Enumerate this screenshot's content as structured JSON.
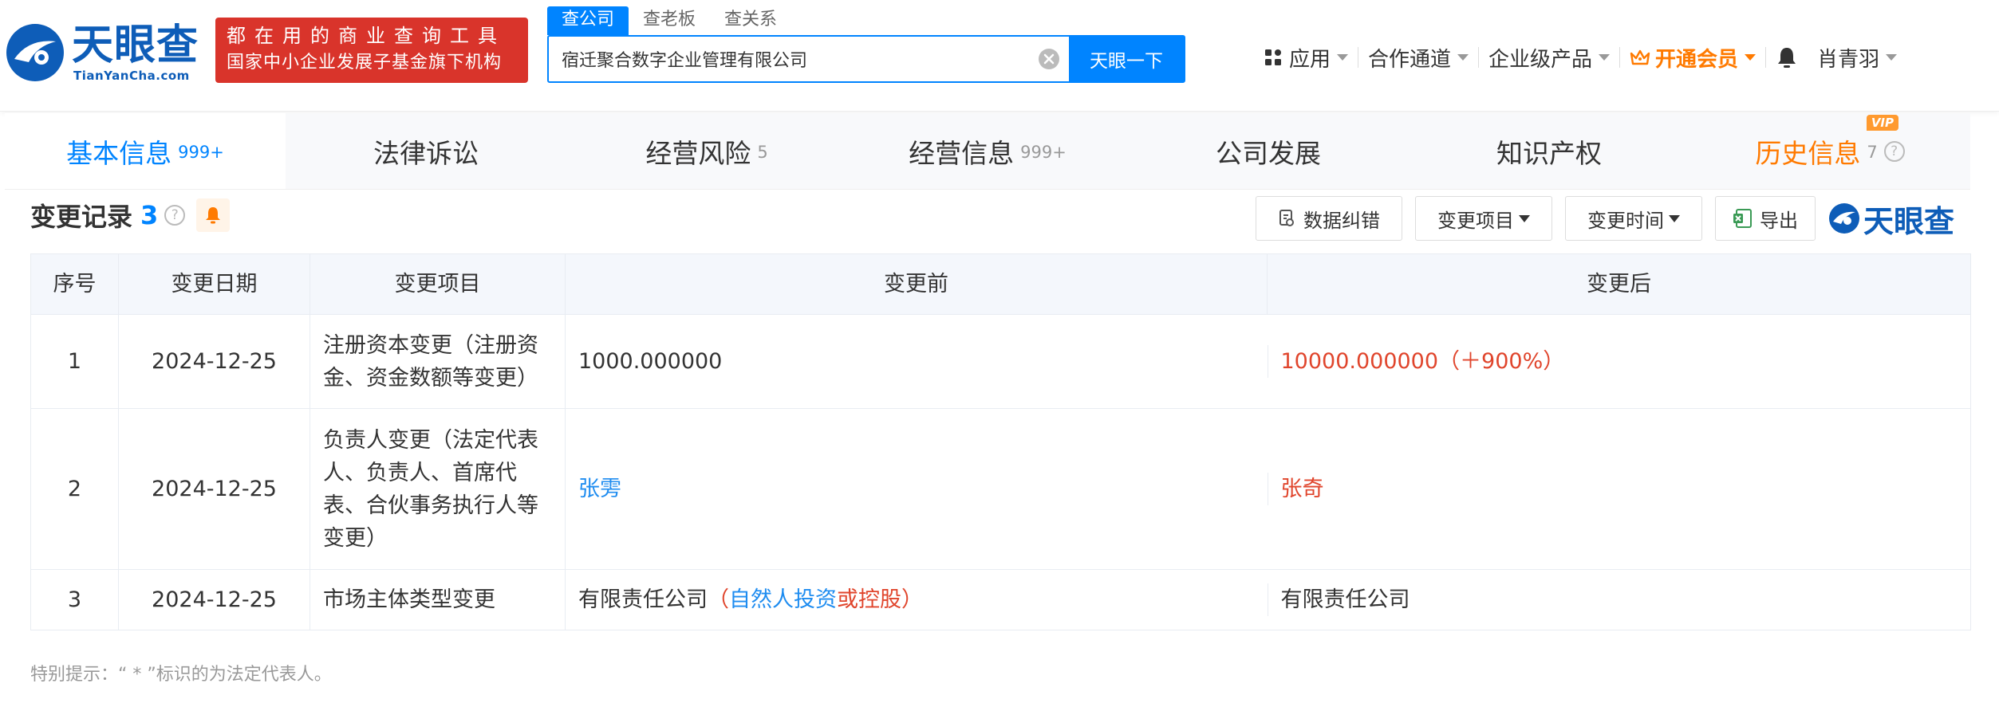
{
  "brand": {
    "name": "天眼查",
    "domain": "TianYanCha.com",
    "promo_line1": "都在用的商业查询工具",
    "promo_line2": "国家中小企业发展子基金旗下机构"
  },
  "search": {
    "tabs": [
      {
        "label": "查公司",
        "active": true
      },
      {
        "label": "查老板",
        "active": false
      },
      {
        "label": "查关系",
        "active": false
      }
    ],
    "value": "宿迁聚合数字企业管理有限公司",
    "button": "天眼一下"
  },
  "nav": {
    "apps": "应用",
    "partner": "合作通道",
    "enterprise": "企业级产品",
    "vip": "开通会员",
    "user": "肖青羽"
  },
  "colors": {
    "primary": "#0084ff",
    "brand": "#0e5db8",
    "vip": "#ff7a00",
    "red": "#e0452c",
    "promo": "#d9342b"
  },
  "section_tabs": [
    {
      "label": "基本信息",
      "count": "999+",
      "active": true
    },
    {
      "label": "法律诉讼",
      "count": "",
      "active": false
    },
    {
      "label": "经营风险",
      "count": "5",
      "active": false
    },
    {
      "label": "经营信息",
      "count": "999+",
      "active": false
    },
    {
      "label": "公司发展",
      "count": "",
      "active": false
    },
    {
      "label": "知识产权",
      "count": "",
      "active": false
    },
    {
      "label": "历史信息",
      "count": "7",
      "active": false,
      "badge": "VIP"
    }
  ],
  "section": {
    "title": "变更记录",
    "count": "3",
    "help": "?"
  },
  "toolbar": {
    "correct": "数据纠错",
    "item_filter": "变更项目",
    "time_filter": "变更时间",
    "export": "导出",
    "watermark": "天眼查"
  },
  "table": {
    "headers": [
      "序号",
      "变更日期",
      "变更项目",
      "变更前",
      "变更后"
    ],
    "rows": [
      {
        "no": "1",
        "date": "2024-12-25",
        "item": "注册资本变更（注册资金、资金数额等变更）",
        "before": "1000.000000",
        "after": "10000.000000（＋900%）"
      },
      {
        "no": "2",
        "date": "2024-12-25",
        "item": "负责人变更（法定代表人、负责人、首席代表、合伙事务执行人等变更）",
        "before": "张雱",
        "after": "张奇"
      },
      {
        "no": "3",
        "date": "2024-12-25",
        "item": "市场主体类型变更",
        "before_plain": "有限责任公司",
        "before_paren_open": "（",
        "before_blue": "自然人投资",
        "before_red": "或控股）",
        "after": "有限责任公司"
      }
    ]
  },
  "note": "特别提示：“ * ”标识的为法定代表人。"
}
